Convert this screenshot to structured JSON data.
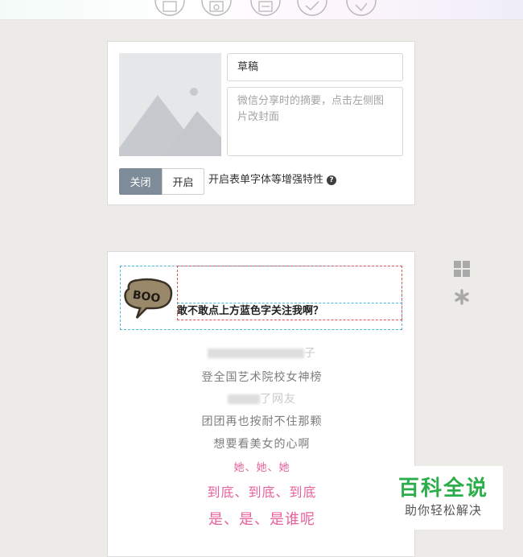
{
  "toolbar": {
    "icons": [
      "image-frame-icon",
      "media-icon",
      "save-icon",
      "check-circle-icon",
      "check-circle-icon"
    ]
  },
  "article_settings": {
    "title_value": "草稿",
    "summary_placeholder": "微信分享时的摘要，点击左侧图片改封面",
    "toggle_off_label": "关闭",
    "toggle_on_label": "开启",
    "toggle_selected": "关闭",
    "feature_label": "开启表单字体等增强特性",
    "help_symbol": "?"
  },
  "editor": {
    "sticker_text": "BOO",
    "headline": "敢不敢点上方蓝色字关注我啊？",
    "lines": [
      {
        "text": "子",
        "blurred": true
      },
      {
        "text": "登全国艺术院校女神榜",
        "blurred": false
      },
      {
        "text": "了网友",
        "blurred": true
      },
      {
        "text": "团团再也按耐不住那颗",
        "blurred": false
      },
      {
        "text": "想要看美女的心啊",
        "blurred": false
      },
      {
        "text": "她、她、她",
        "blurred": false
      },
      {
        "text": "到底、到底、到底",
        "blurred": false
      },
      {
        "text": "是、是、是谁呢",
        "blurred": false
      }
    ]
  },
  "side_tools": [
    "grid-icon",
    "asterisk-icon"
  ],
  "watermark": {
    "main": "百科全说",
    "sub": "助你轻松解决"
  },
  "colors": {
    "background": "#ecebe8",
    "toggle_active": "#7e8b99",
    "dashed_blue": "#4db6d8",
    "dashed_red": "#e25757",
    "pink_text": "#e8619b",
    "watermark_green": "#2bad4b"
  }
}
